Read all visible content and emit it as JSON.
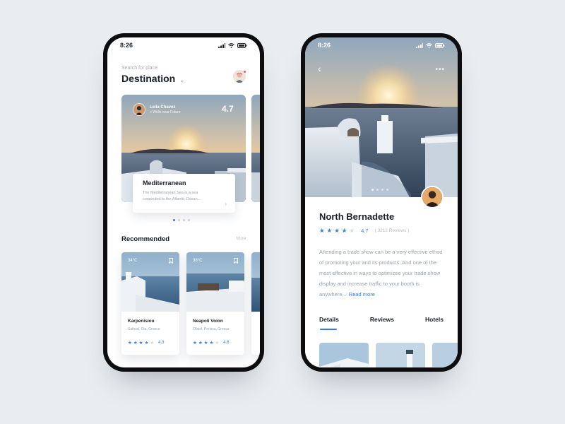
{
  "left_screen": {
    "status": {
      "time": "8:26"
    },
    "search_label": "Search for place",
    "title": "Destination",
    "featured": {
      "user_name": "Lelia Chavez",
      "user_location": "Wells near Future",
      "rating": "4.7",
      "card_title": "Mediterranean",
      "card_desc": "The Mediterranean Sea is a sea connected to the Atlantic Ocean..."
    },
    "recommended": {
      "title": "Recommended",
      "more": "More",
      "items": [
        {
          "temp": "34°C",
          "name": "Karpenisiou",
          "sub": "Safood, Oia, Greece",
          "rating": "4.3",
          "stars": 4
        },
        {
          "temp": "38°C",
          "name": "Neapoli Voion",
          "sub": "Ofaisf, Perissa, Greece",
          "rating": "4.6",
          "stars": 4
        }
      ]
    }
  },
  "right_screen": {
    "status": {
      "time": "8:26"
    },
    "place_name": "North Bernadette",
    "rating": "4.7",
    "review_count": "( 3212 Reviews )",
    "stars": 4,
    "description": "Attending a trade show can be a very effective ethod of promoting your and its products. And one of the most effective in ways to optimizee your trade show display and increase traffic to your booth is anywhere...",
    "read_more": "Read more",
    "tabs": [
      "Details",
      "Reviews",
      "Hotels"
    ]
  },
  "colors": {
    "accent": "#2f7ff0",
    "background": "#e9edf0",
    "phone_frame": "#0d0d0f",
    "notification": "#ff4d4d"
  },
  "icons": [
    "signal-icon",
    "wifi-icon",
    "battery-icon",
    "chevron-down-icon",
    "location-pin-icon",
    "chevron-right-icon",
    "bookmark-icon",
    "star-icon",
    "back-arrow-icon",
    "more-dots-icon"
  ]
}
